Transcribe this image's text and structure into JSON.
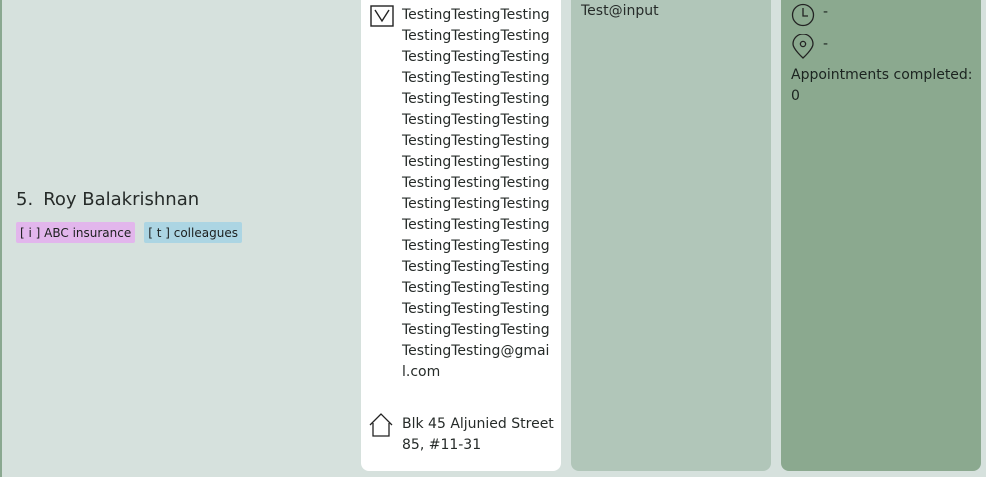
{
  "person": {
    "index": "5.",
    "name": "Roy Balakrishnan",
    "tags": [
      {
        "label": "[ i ] ABC insurance",
        "kind": "insurance",
        "color": "#e2b6ec"
      },
      {
        "label": "[ t ] colleagues",
        "kind": "tag",
        "color": "#acd5e3"
      }
    ]
  },
  "contact": {
    "email": "TestingTestingTestingTestingTestingTestingTestingTestingTestingTestingTestingTestingTestingTestingTestingTestingTestingTestingTestingTestingTestingTestingTestingTestingTestingTestingTestingTestingTestingTestingTestingTestingTestingTestingTestingTestingTestingTestingTestingTestingTestingTestingTestingTestingTestingTestingTestingTestingTestingTesting@gmail.com",
    "address": "Blk 45 Aljunied Street 85, #11-31"
  },
  "remark": "Test@input",
  "schedule": {
    "time": "-",
    "location": "-",
    "appointments": "Appointments completed: 0"
  },
  "icons": {
    "email": "mail-icon",
    "address": "home-icon",
    "time": "clock-icon",
    "location": "location-pin-icon"
  },
  "colors": {
    "background": "#d6e1dd",
    "panel_white": "#ffffff",
    "panel_mid": "#b1c6b9",
    "panel_dark": "#8ba98f"
  }
}
